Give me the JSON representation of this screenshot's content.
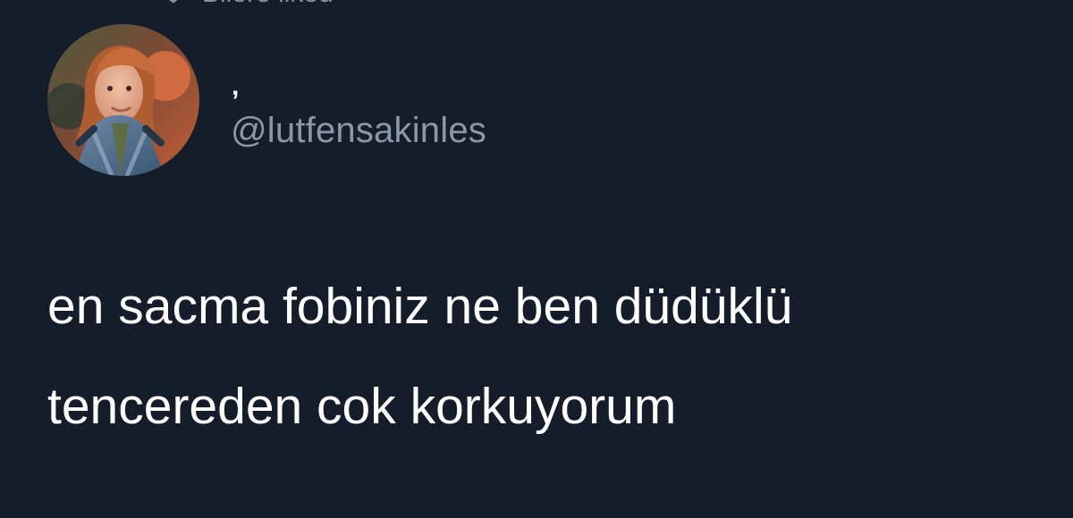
{
  "tweet": {
    "social_context": "Bilere liked",
    "author": {
      "display_name": ",",
      "username": "@lutfensakinles"
    },
    "text_lines": [
      "en sacma fobiniz ne ben düdüklü",
      "tencereden cok korkuyorum"
    ]
  },
  "colors": {
    "background": "#151d2b",
    "primary_text": "#ffffff",
    "secondary_text": "#8b98a5"
  },
  "icons": {
    "social_context_icon": "heart-icon"
  }
}
